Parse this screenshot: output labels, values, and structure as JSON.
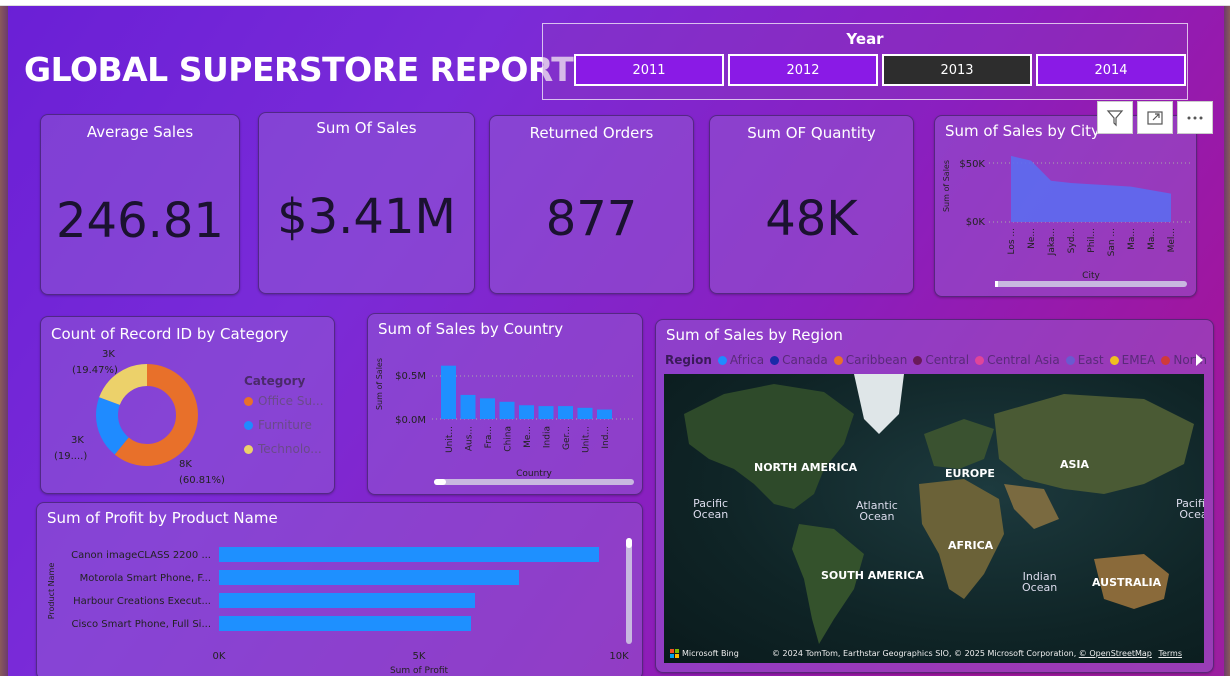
{
  "title": "GLOBAL SUPERSTORE REPORT",
  "year_slicer": {
    "label": "Year",
    "options": [
      "2011",
      "2012",
      "2013",
      "2014"
    ],
    "selected": "2013"
  },
  "kpis": [
    {
      "label": "Average Sales",
      "value": "246.81"
    },
    {
      "label": "Sum Of Sales",
      "value": "$3.41M"
    },
    {
      "label": "Returned Orders",
      "value": "877"
    },
    {
      "label": "Sum OF Quantity",
      "value": "48K"
    }
  ],
  "toolbar": [
    "filter-icon",
    "focus-mode-icon",
    "more-options-icon"
  ],
  "colors": {
    "bar_blue": "#1e90ff",
    "area_blue": "#5c6bf0",
    "office": "#e8702a",
    "furniture": "#1f8bff",
    "technology": "#ecd16a",
    "selected_year": "#2d2d2d",
    "year_btn": "#8a1ae6"
  },
  "city_chart": {
    "title": "Sum of Sales by City",
    "ylabel": "Sum of Sales",
    "xlabel": "City",
    "yticks": [
      "$50K",
      "$0K"
    ],
    "categories": [
      "Los ...",
      "Ne...",
      "Jaka...",
      "Syd...",
      "Phil...",
      "San ...",
      "Ma...",
      "Ma...",
      "Mel..."
    ]
  },
  "category_chart": {
    "title": "Count of Record ID by Category",
    "legend_title": "Category",
    "legend": [
      "Office Su...",
      "Furniture",
      "Technolo..."
    ],
    "labels": {
      "tech_value": "3K",
      "tech_pct": "(19.47%)",
      "furn_value": "3K",
      "furn_pct": "(19....)",
      "office_value": "8K",
      "office_pct": "(60.81%)"
    }
  },
  "country_chart": {
    "title": "Sum of Sales by Country",
    "ylabel": "Sum of Sales",
    "xlabel": "Country",
    "yticks": [
      "$0.5M",
      "$0.0M"
    ],
    "categories": [
      "Unit...",
      "Aus...",
      "Fra...",
      "China",
      "Me...",
      "India",
      "Ger...",
      "Unit...",
      "Ind..."
    ]
  },
  "profit_chart": {
    "title": "Sum of Profit by Product Name",
    "ylabel": "Product Name",
    "xlabel": "Sum of Profit",
    "xticks": [
      "0K",
      "5K",
      "10K"
    ],
    "products": [
      "Canon imageCLASS 2200 ...",
      "Motorola Smart Phone, F...",
      "Harbour Creations Execut...",
      "Cisco Smart Phone, Full Si..."
    ]
  },
  "region_chart": {
    "title": "Sum of Sales by Region",
    "legend_title": "Region",
    "regions": [
      {
        "name": "Africa",
        "color": "#1f8bff"
      },
      {
        "name": "Canada",
        "color": "#1a2aa8"
      },
      {
        "name": "Caribbean",
        "color": "#e8702a"
      },
      {
        "name": "Central",
        "color": "#6a1a5a"
      },
      {
        "name": "Central Asia",
        "color": "#e0459a"
      },
      {
        "name": "East",
        "color": "#6a5ad0"
      },
      {
        "name": "EMEA",
        "color": "#f0c020"
      },
      {
        "name": "North",
        "color": "#d03a3a"
      }
    ],
    "continents": [
      "NORTH AMERICA",
      "EUROPE",
      "ASIA",
      "AFRICA",
      "SOUTH AMERICA",
      "AUSTRALIA"
    ],
    "oceans": [
      "Pacific\nOcean",
      "Atlantic\nOcean",
      "Indian\nOcean",
      "Pacific\nOcea"
    ],
    "bing": "Microsoft Bing",
    "attribution": "© 2024 TomTom, Earthstar Geographics SIO, © 2025 Microsoft Corporation,",
    "osm": "© OpenStreetMap",
    "terms": "Terms"
  },
  "chart_data": [
    {
      "type": "area",
      "title": "Sum of Sales by City",
      "xlabel": "City",
      "ylabel": "Sum of Sales",
      "x": [
        "Los ...",
        "Ne...",
        "Jaka...",
        "Syd...",
        "Phil...",
        "San ...",
        "Ma...",
        "Ma...",
        "Mel..."
      ],
      "values": [
        56000,
        52000,
        35000,
        33000,
        32000,
        31000,
        30000,
        27000,
        24000
      ],
      "ylim": [
        0,
        60000
      ]
    },
    {
      "type": "pie",
      "title": "Count of Record ID by Category",
      "categories": [
        "Office Su...",
        "Furniture",
        "Technolo..."
      ],
      "values": [
        60.81,
        19.72,
        19.47
      ]
    },
    {
      "type": "bar",
      "title": "Sum of Sales by Country",
      "xlabel": "Country",
      "ylabel": "Sum of Sales",
      "categories": [
        "Unit...",
        "Aus...",
        "Fra...",
        "China",
        "Me...",
        "India",
        "Ger...",
        "Unit...",
        "Ind..."
      ],
      "values": [
        0.62,
        0.28,
        0.24,
        0.2,
        0.16,
        0.15,
        0.15,
        0.13,
        0.11
      ],
      "ylim": [
        0,
        0.8
      ]
    },
    {
      "type": "bar",
      "title": "Sum of Profit by Product Name",
      "xlabel": "Sum of Profit",
      "ylabel": "Product Name",
      "categories": [
        "Canon imageCLASS 2200 ...",
        "Motorola Smart Phone, F...",
        "Harbour Creations Execut...",
        "Cisco Smart Phone, Full Si..."
      ],
      "values": [
        9500,
        7500,
        6400,
        6300
      ],
      "xlim": [
        0,
        10000
      ]
    }
  ]
}
